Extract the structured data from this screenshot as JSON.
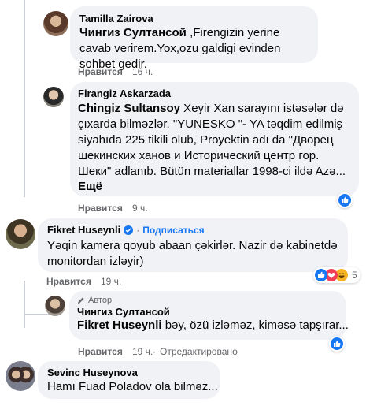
{
  "comments": [
    {
      "author": "Tamilla Zairova",
      "mention": "Чингиз Султансой",
      "text": " ,Firengizin yerine cavab verirem.Yox,ozu galdigi evinden sohbet gedir.",
      "like": "Нравится",
      "time": "16 ч."
    },
    {
      "author": "Firangiz Askarzada",
      "mention": "Chingiz Sultansoy",
      "text": " Xeyir Xan sarayını istəsələr də çıxarda bilməzlər. \"YUNESKO \"- YA təqdim edilmiş siyahıda 225 tikili olub, Proyektin adı da \"Дворец шекинских ханов и Исторический центр гор. Шеки\" adlanıb. Bütün materiallar 1998-ci ildə Azə...",
      "see_more": "Ещё",
      "like": "Нравится",
      "time": "9 ч."
    },
    {
      "author": "Fikret Huseynli",
      "follow": "Подписаться",
      "text": "Yəqin kamera qoyub abaan çəkirlər. Nazir də kabinetdə monitordan izləyir)",
      "like": "Нравится",
      "time": "19 ч.",
      "reaction_count": "5"
    },
    {
      "badge": "Автор",
      "author": "Чингиз Султансой",
      "mention": "Fikret Huseynli",
      "text": " bəy, özü izləməz, kiməsə tapşırar...",
      "like": "Нравится",
      "time": "19 ч.",
      "edited": "Отредактировано"
    },
    {
      "author": "Sevinc Huseynova",
      "text": "Hamı Fuad Poladov ola bilməz..."
    }
  ],
  "colors": {
    "bubble": "#f0f2f5",
    "meta": "#65676b",
    "like_blue": "#1877f2",
    "love_red": "#f33e58",
    "haha_yellow": "#f7b125"
  }
}
